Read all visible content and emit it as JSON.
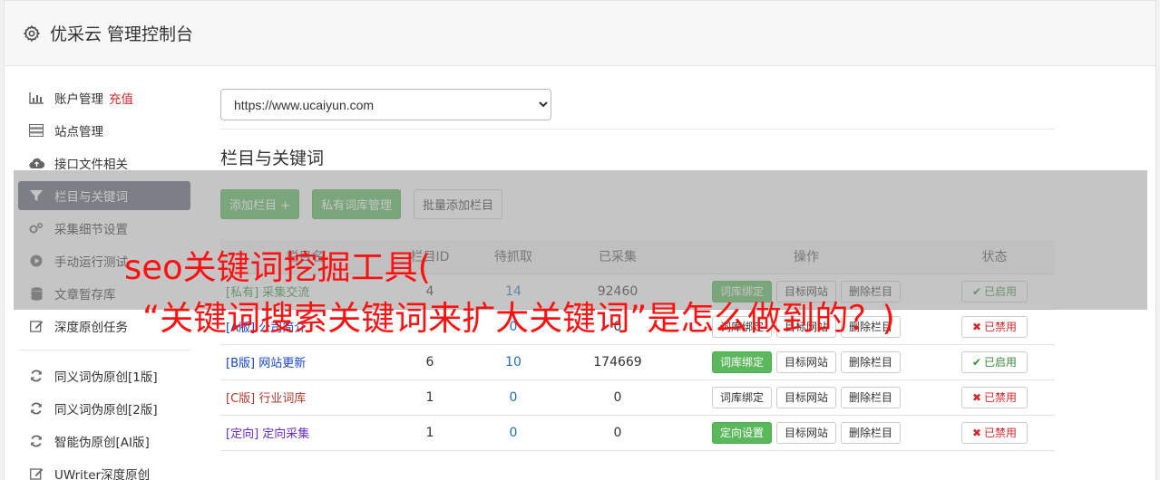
{
  "header": {
    "title": "优采云 管理控制台",
    "icon": "gear-icon"
  },
  "sidebar": {
    "items": [
      {
        "label": "账户管理",
        "extra": "充值",
        "icon": "bar-chart-icon"
      },
      {
        "label": "站点管理",
        "icon": "server-icon"
      },
      {
        "label": "接口文件相关",
        "icon": "cloud-upload-icon"
      },
      {
        "label": "栏目与关键词",
        "icon": "filter-icon",
        "active": true
      },
      {
        "label": "采集细节设置",
        "icon": "cogs-icon"
      },
      {
        "label": "手动运行测试",
        "icon": "play-circle-icon"
      },
      {
        "label": "文章暂存库",
        "icon": "database-icon"
      },
      {
        "label": "深度原创任务",
        "icon": "edit-icon"
      },
      {
        "label": "同义词伪原创[1版]",
        "icon": "refresh-icon"
      },
      {
        "label": "同义词伪原创[2版]",
        "icon": "refresh-icon"
      },
      {
        "label": "智能伪原创[AI版]",
        "icon": "refresh-icon"
      },
      {
        "label": "UWriter深度原创",
        "icon": "edit-icon"
      }
    ]
  },
  "main": {
    "site_select": {
      "value": "https://www.ucaiyun.com"
    },
    "section_title": "栏目与关键词",
    "buttons": {
      "add_column": "添加栏目 +",
      "private_lib": "私有词库管理",
      "batch_add": "批量添加栏目"
    },
    "table": {
      "headers": [
        "栏目名",
        "栏目ID",
        "待抓取",
        "已采集",
        "操作",
        "状态"
      ],
      "rows": [
        {
          "tag": "[私有]",
          "name": "采集交流",
          "col2": "4",
          "pending": "14",
          "collected": "92460",
          "op1": "词库绑定",
          "op1_green": true,
          "op2": "目标网站",
          "op3": "删除栏目",
          "status": "已启用",
          "enabled": true,
          "color": "#3a8e3a"
        },
        {
          "tag": "[A版]",
          "name": "公司简介",
          "col2": "",
          "pending": "0",
          "collected": "0",
          "op1": "词库绑定",
          "op1_green": false,
          "op2": "目标网站",
          "op3": "删除栏目",
          "status": "已禁用",
          "enabled": false,
          "color": "#1645d6"
        },
        {
          "tag": "[B版]",
          "name": "网站更新",
          "col2": "6",
          "pending": "10",
          "collected": "174669",
          "op1": "词库绑定",
          "op1_green": true,
          "op2": "目标网站",
          "op3": "删除栏目",
          "status": "已启用",
          "enabled": true,
          "color": "#1645d6"
        },
        {
          "tag": "[C版]",
          "name": "行业词库",
          "col2": "1",
          "pending": "0",
          "collected": "0",
          "op1": "词库绑定",
          "op1_green": false,
          "op2": "目标网站",
          "op3": "删除栏目",
          "status": "已禁用",
          "enabled": false,
          "color": "#b23a2a"
        },
        {
          "tag": "[定向]",
          "name": "定向采集",
          "col2": "1",
          "pending": "0",
          "collected": "0",
          "op1": "定向设置",
          "op1_green": true,
          "op2": "目标网站",
          "op3": "删除栏目",
          "status": "已禁用",
          "enabled": false,
          "color": "#6b2bd0"
        }
      ]
    }
  },
  "overlay": {
    "line1": "seo关键词挖掘工具(",
    "line2": "“关键词搜索关键词来扩大关键词”是怎么做到的？)"
  }
}
